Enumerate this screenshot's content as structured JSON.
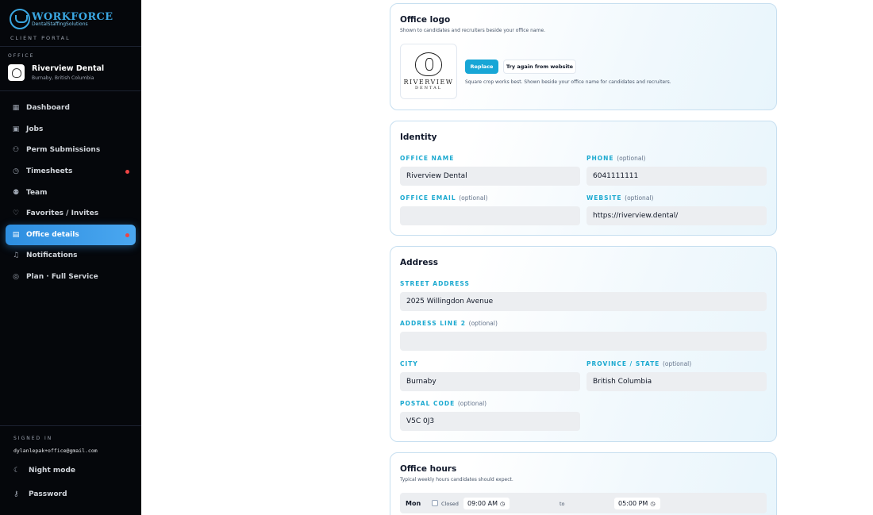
{
  "sidebar": {
    "brand_name": "WORKFORCE",
    "brand_sub": "DentalStaffingSolutions",
    "portal_label": "CLIENT PORTAL",
    "office_label": "OFFICE",
    "office_name": "Riverview Dental",
    "office_location": "Burnaby, British Columbia",
    "nav": [
      {
        "label": "Dashboard",
        "icon": "grid-icon"
      },
      {
        "label": "Jobs",
        "icon": "briefcase-icon"
      },
      {
        "label": "Perm Submissions",
        "icon": "user-plus-icon"
      },
      {
        "label": "Timesheets",
        "icon": "clock-icon",
        "badge": true
      },
      {
        "label": "Team",
        "icon": "users-icon"
      },
      {
        "label": "Favorites / Invites",
        "icon": "heart-icon"
      },
      {
        "label": "Office details",
        "icon": "building-icon",
        "active": true,
        "badge": true
      },
      {
        "label": "Notifications",
        "icon": "bell-icon"
      },
      {
        "label": "Plan · Full Service",
        "icon": "check-circle-icon"
      }
    ],
    "signed_in_label": "SIGNED IN",
    "signed_in_email": "dylanlepak+office@gmail.com",
    "night_mode": "Night mode",
    "password": "Password"
  },
  "logo_card": {
    "title": "Office logo",
    "subtitle": "Shown to candidates and recruiters beside your office name.",
    "logo_word": "RIVERVIEW",
    "logo_word2": "DENTAL",
    "replace": "Replace",
    "try_again": "Try again from website",
    "hint": "Square crop works best. Shown beside your office name for candidates and recruiters."
  },
  "identity": {
    "title": "Identity",
    "office_name_label": "OFFICE NAME",
    "office_name": "Riverview Dental",
    "phone_label": "PHONE",
    "phone": "6041111111",
    "email_label": "OFFICE EMAIL",
    "email": "",
    "website_label": "WEBSITE",
    "website": "https://riverview.dental/",
    "optional": "(optional)"
  },
  "address": {
    "title": "Address",
    "street_label": "STREET ADDRESS",
    "street": "2025 Willingdon Avenue",
    "line2_label": "ADDRESS LINE 2",
    "line2": "",
    "city_label": "CITY",
    "city": "Burnaby",
    "province_label": "PROVINCE / STATE",
    "province": "British Columbia",
    "postal_label": "POSTAL CODE",
    "postal": "V5C 0J3",
    "optional": "(optional)"
  },
  "hours": {
    "title": "Office hours",
    "subtitle": "Typical weekly hours candidates should expect.",
    "day": "Mon",
    "closed": "Closed",
    "open": "09:00 AM",
    "to": "to",
    "close": "05:00 PM"
  },
  "colors": {
    "accent": "#17a6d6",
    "active_nav": "#3b9ae8",
    "badge": "#ef4444"
  }
}
